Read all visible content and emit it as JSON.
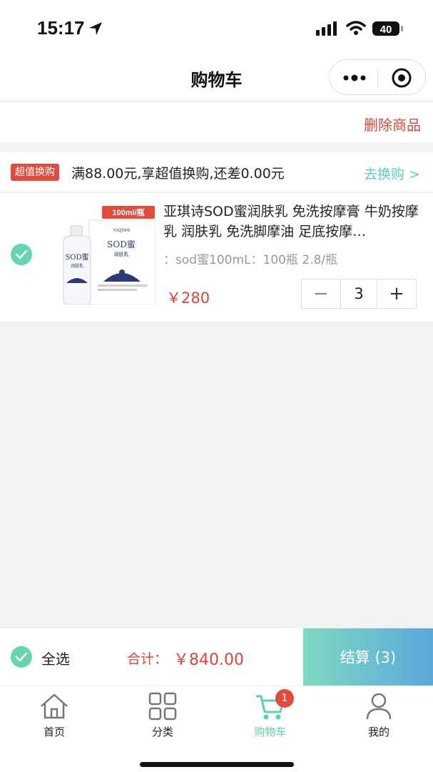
{
  "status_bar": {
    "time": "15:17",
    "battery": "40"
  },
  "header": {
    "title": "购物车"
  },
  "toolbar": {
    "delete_label": "删除商品"
  },
  "promo": {
    "badge": "超值换购",
    "text": "满88.00元,享超值换购,还差0.00元",
    "link": "去换购 >"
  },
  "cart_item": {
    "image_tag": "100ml/瓶",
    "title": "亚琪诗SOD蜜润肤乳 免洗按摩膏 牛奶按摩乳 润肤乳 免洗脚摩油 足底按摩…",
    "spec": "：sod蜜100mL：100瓶 2.8/瓶",
    "price": "￥280",
    "quantity": "3",
    "minus": "−",
    "plus": "+",
    "checked": true,
    "product_brand": "YAQISHI",
    "product_name": "SOD蜜",
    "product_sub": "润肤乳"
  },
  "checkout": {
    "select_all_label": "全选",
    "total_label": "合计：",
    "total_value": "￥840.00",
    "button_label": "结算 (3)"
  },
  "tabs": [
    {
      "label": "首页",
      "icon": "home-icon"
    },
    {
      "label": "分类",
      "icon": "grid-icon"
    },
    {
      "label": "购物车",
      "icon": "cart-icon",
      "badge": "1",
      "active": true
    },
    {
      "label": "我的",
      "icon": "user-icon"
    }
  ],
  "colors": {
    "accent": "#5ecfb4",
    "price": "#d9473b",
    "badge": "#e24c3f"
  }
}
